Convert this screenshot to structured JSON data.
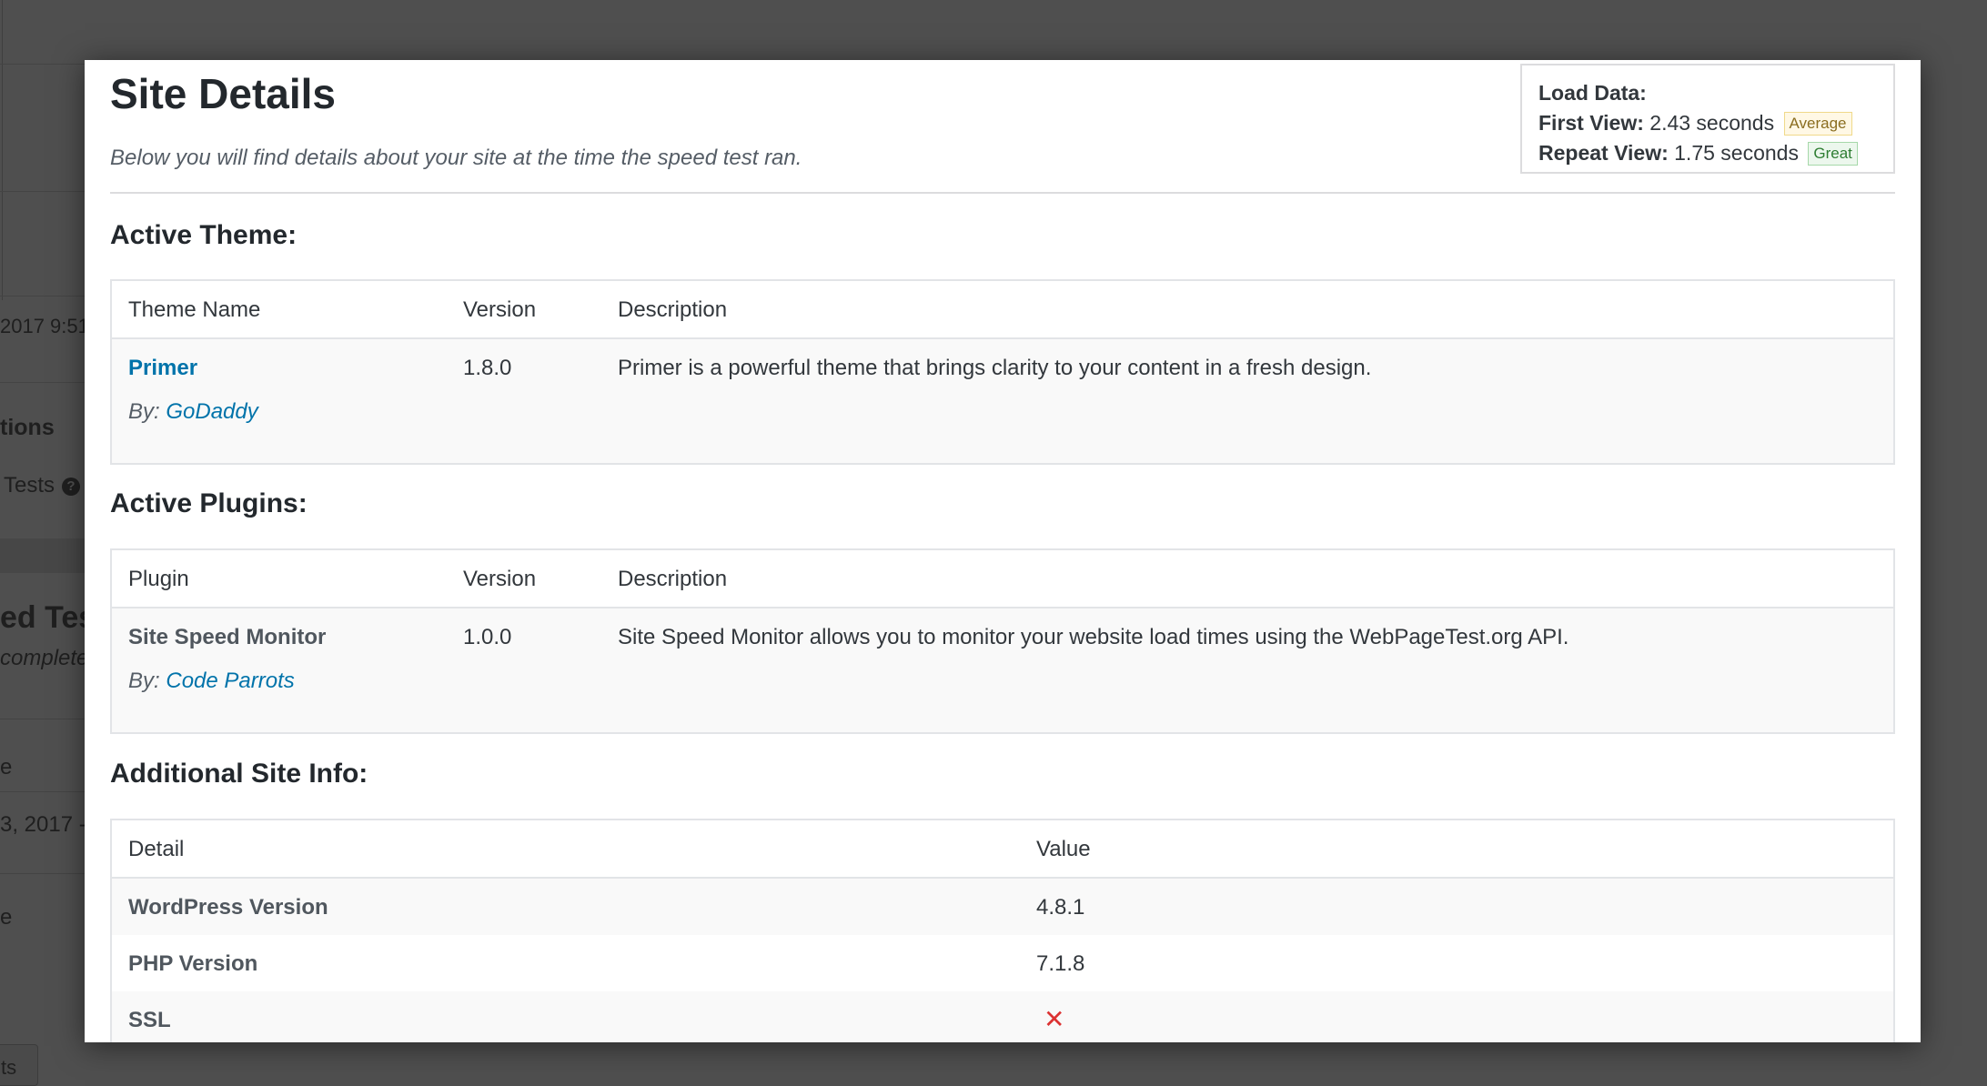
{
  "background": {
    "fragments": {
      "timestamp": "2017 9:51",
      "options_heading": "tions",
      "tests_label": "Tests",
      "help_icon": "?",
      "speed_test_heading": "ed Tes",
      "complete_text": "complete",
      "col_fragment_1": "e",
      "date_fragment": "3, 2017 -",
      "col_fragment_2": "e",
      "button_fragment": "ts"
    }
  },
  "modal": {
    "title": "Site Details",
    "subtitle": "Below you will find details about your site at the time the speed test ran.",
    "load_data": {
      "heading": "Load Data:",
      "first_view_label": "First View:",
      "first_view_value": "2.43 seconds",
      "first_view_badge": "Average",
      "repeat_view_label": "Repeat View:",
      "repeat_view_value": "1.75 seconds",
      "repeat_view_badge": "Great",
      "colors": {
        "average_badge": "#fff8e5",
        "great_badge": "#ecf7ed"
      }
    },
    "active_theme": {
      "heading": "Active Theme:",
      "columns": [
        "Theme Name",
        "Version",
        "Description"
      ],
      "rows": [
        {
          "name": "Primer",
          "by_prefix": "By:",
          "author": "GoDaddy",
          "version": "1.8.0",
          "description": "Primer is a powerful theme that brings clarity to your content in a fresh design."
        }
      ]
    },
    "active_plugins": {
      "heading": "Active Plugins:",
      "columns": [
        "Plugin",
        "Version",
        "Description"
      ],
      "rows": [
        {
          "name": "Site Speed Monitor",
          "by_prefix": "By:",
          "author": "Code Parrots",
          "version": "1.0.0",
          "description": "Site Speed Monitor allows you to monitor your website load times using the WebPageTest.org API."
        }
      ]
    },
    "additional_info": {
      "heading": "Additional Site Info:",
      "columns": [
        "Detail",
        "Value"
      ],
      "rows": [
        {
          "detail": "WordPress Version",
          "value": "4.8.1"
        },
        {
          "detail": "PHP Version",
          "value": "7.1.8"
        },
        {
          "detail": "SSL",
          "value": "✕",
          "icon": "x-mark-icon"
        }
      ]
    },
    "colors": {
      "link": "#0073aa",
      "error": "#dc3232"
    }
  }
}
